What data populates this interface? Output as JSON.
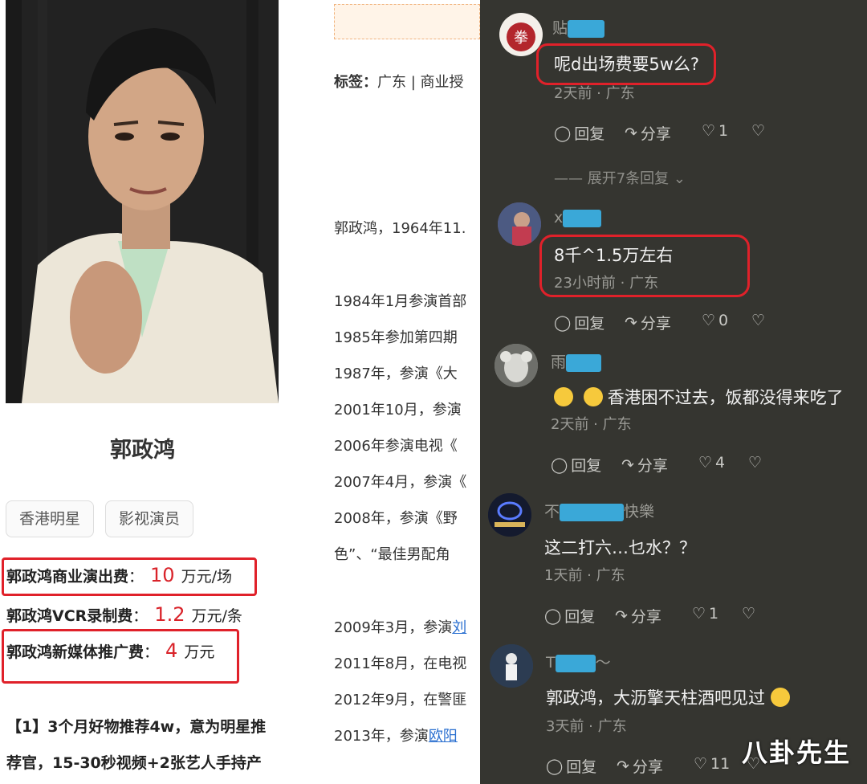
{
  "profile": {
    "name": "郭政鸿",
    "tags": [
      "香港明星",
      "影视演员"
    ],
    "fees": [
      {
        "label": "郭政鸿商业演出费",
        "value": "10",
        "unit": "万元/场"
      },
      {
        "label": "郭政鸿VCR录制费",
        "value": "1.2",
        "unit": "万元/条"
      },
      {
        "label": "郭政鸿新媒体推广费",
        "value": "4",
        "unit": "万元"
      }
    ],
    "promo_line1": "【1】3个月好物推荐4w，意为明星推",
    "promo_line2": "荐官，15-30秒视频+2张艺人手持产"
  },
  "article": {
    "tags_label": "标签：",
    "tags_text": "广东 | 商业授",
    "intro": "郭政鸿，1964年11.",
    "lines": [
      "1984年1月参演首部",
      "1985年参加第四期",
      "1987年，参演《大",
      "2001年10月，参演",
      "2006年参演电视《",
      "2007年4月，参演《",
      "2008年，参演《野",
      "色”、“最佳男配角"
    ],
    "line_2009_prefix": "2009年3月，参演",
    "line_2009_link": "刘",
    "line_2011": "2011年8月，在电视",
    "line_2012": "2012年9月，在警匪",
    "line_2013_prefix": "2013年，参演",
    "line_2013_link": "欧阳"
  },
  "comments": [
    {
      "username": "贴",
      "text": "呢d出场费要5w么?",
      "meta": "2天前 · 广东",
      "likes": "1",
      "expand": "展开7条回复",
      "avatar_color": "#b3262c",
      "avatar_char": "拳"
    },
    {
      "username": "x",
      "text": "8千^1.5万左右",
      "meta": "23小时前 · 广东",
      "likes": "0",
      "avatar_color": "#6b5a8a"
    },
    {
      "username": "雨",
      "text": "香港困不过去，饭都没得来吃了",
      "meta": "2天前 · 广东",
      "likes": "4",
      "avatar_color": "#8f8f88"
    },
    {
      "username": "不",
      "username_suffix": "快樂",
      "text": "这二打六…乜水？？",
      "meta": "1天前 · 广东",
      "likes": "1",
      "avatar_color": "#1e2540"
    },
    {
      "username": "T",
      "username_suffix": "～",
      "text": "郭政鸿，大沥擎天柱酒吧见过",
      "meta": "3天前 · 广东",
      "likes": "11",
      "avatar_color": "#33475e"
    }
  ],
  "actions": {
    "reply": "回复",
    "share": "分享"
  },
  "watermark": "八卦先生",
  "colors": {
    "highlight_red": "#e0212a",
    "fee_red": "#d9232a",
    "comment_bg": "#353530",
    "link": "#2a6fd0"
  }
}
